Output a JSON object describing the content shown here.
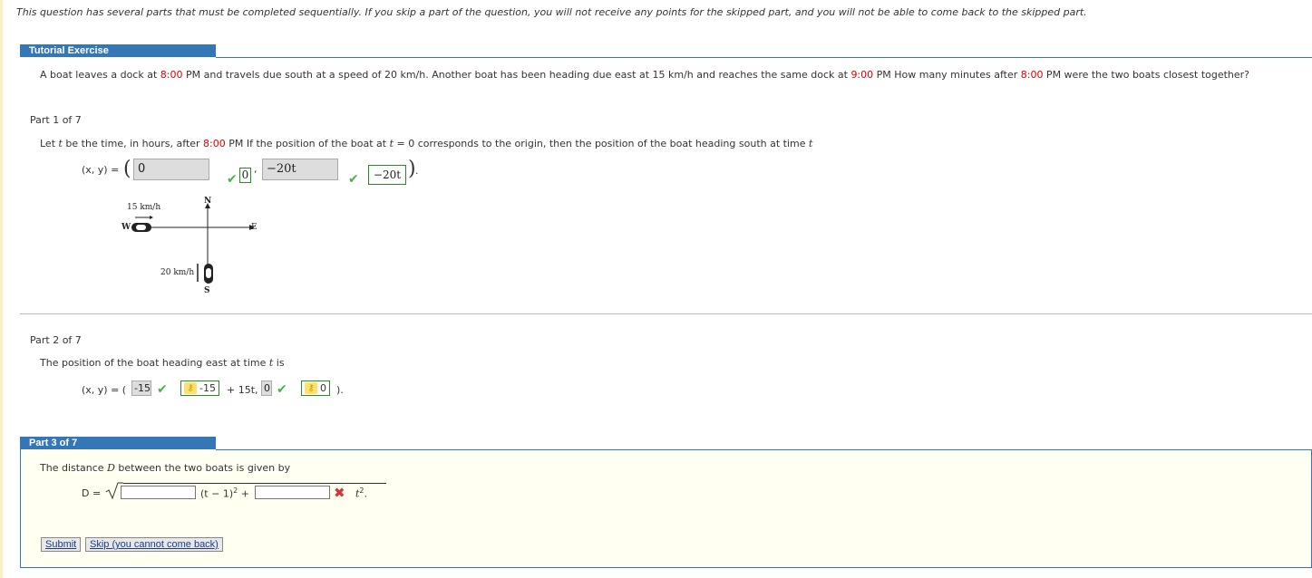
{
  "notice": "This question has several parts that must be completed sequentially. If you skip a part of the question, you will not receive any points for the skipped part, and you will not be able to come back to the skipped part.",
  "tutorial": {
    "header": "Tutorial Exercise",
    "problem": {
      "t1": "A boat leaves a dock at ",
      "time1": "8:00",
      "t2": " PM and travels due south at a speed of 20 km/h. Another boat has been heading due east at 15 km/h and reaches the same dock at ",
      "time2": "9:00",
      "t3": " PM How many minutes after ",
      "time3": "8:00",
      "t4": " PM were the two boats closest together?"
    }
  },
  "part1": {
    "label": "Part 1 of 7",
    "s1": "Let ",
    "t": "t",
    "s2": " be the time, in hours, after ",
    "time": "8:00",
    "s3": " PM If the position of the boat at ",
    "s4": " = 0 corresponds to the origin, then the position of the boat heading south at time ",
    "eq_lhs": "(x, y) =",
    "input1": "0",
    "answer1": "0",
    "input2": "−20t",
    "answer2": "−20t",
    "diagram": {
      "n": "N",
      "s": "S",
      "e": "E",
      "w": "W",
      "east_speed": "15 km/h",
      "south_speed": "20 km/h"
    }
  },
  "part2": {
    "label": "Part 2 of 7",
    "text": "The position of the boat heading east at time ",
    "t": "t",
    "text2": " is",
    "eq_lhs": "(x, y) = (",
    "input1": "-15",
    "key1": "-15",
    "plus": "+ 15t,",
    "input2": "0",
    "key2": "0",
    "close": ")."
  },
  "part3": {
    "label": "Part 3 of 7",
    "text": "The distance ",
    "D": "D",
    "text2": " between the two boats is given by",
    "lhs": "D =",
    "mid": "(t − 1)",
    "sup": "2",
    "plus": " +",
    "tail": "t",
    "tail_sup": "2",
    "tail_end": ".",
    "submit": "Submit",
    "skip": "Skip (you cannot come back)"
  }
}
